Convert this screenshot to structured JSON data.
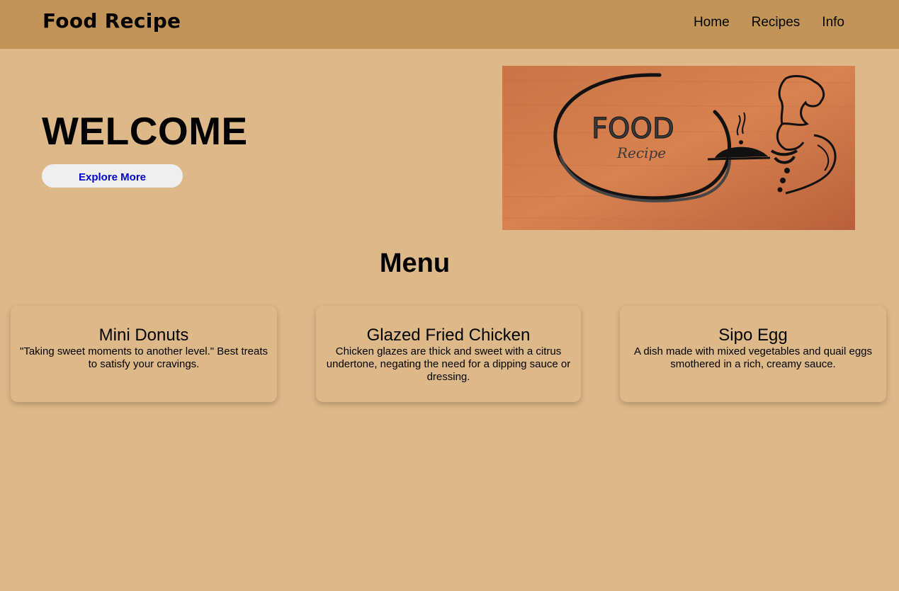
{
  "navbar": {
    "brand": "Food Recipe",
    "links": [
      "Home",
      "Recipes",
      "Info"
    ]
  },
  "hero": {
    "title": "WELCOME",
    "button_label": "Explore More",
    "image": {
      "icon": "chef-logo-icon",
      "logo_text": "FOOD",
      "logo_subtext": "Recipe"
    }
  },
  "menu": {
    "title": "Menu",
    "cards": [
      {
        "title": "Mini Donuts",
        "description": "\"Taking sweet moments to another level.\" Best treats to satisfy your cravings."
      },
      {
        "title": "Glazed Fried Chicken",
        "description": "Chicken glazes are thick and sweet with a citrus undertone, negating the need for a dipping sauce or dressing."
      },
      {
        "title": "Sipo Egg",
        "description": "A dish made with mixed vegetables and quail eggs smothered in a rich, creamy sauce."
      }
    ]
  },
  "colors": {
    "background": "#ddb888",
    "navbar": "#c39457",
    "button_bg": "#efefef",
    "button_text": "#0000cc"
  }
}
